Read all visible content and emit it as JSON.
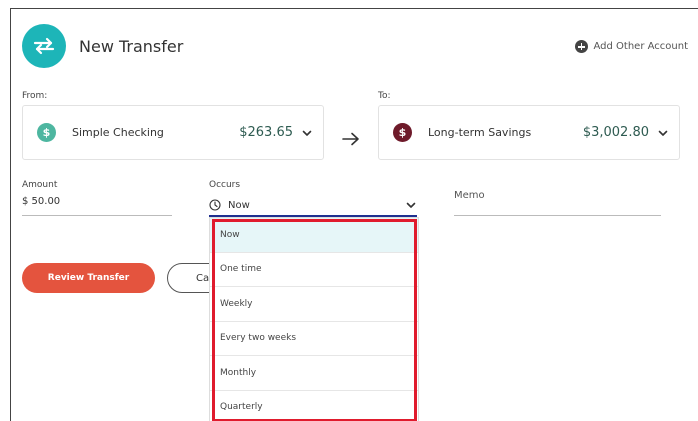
{
  "header": {
    "title": "New Transfer",
    "add_account_label": "Add Other Account"
  },
  "from": {
    "label": "From:",
    "account_name": "Simple Checking",
    "amount": "$263.65",
    "icon_glyph": "$",
    "icon_color": "#4db6a0"
  },
  "to": {
    "label": "To:",
    "account_name": "Long-term Savings",
    "amount": "$3,002.80",
    "icon_glyph": "$",
    "icon_color": "#6e1a2a"
  },
  "amount": {
    "label": "Amount",
    "value": "$ 50.00"
  },
  "occurs": {
    "label": "Occurs",
    "value": "Now",
    "options": [
      "Now",
      "One time",
      "Weekly",
      "Every two weeks",
      "Monthly",
      "Quarterly"
    ],
    "selected_index": 0
  },
  "memo": {
    "label": "Memo"
  },
  "actions": {
    "review_label": "Review Transfer",
    "cancel_label": "Ca"
  },
  "colors": {
    "accent_teal": "#1db5b8",
    "primary_button": "#e4543e",
    "amount_text": "#2e5b51",
    "focus_underline": "#1f2f8f",
    "highlight_border": "#e01b2d"
  }
}
